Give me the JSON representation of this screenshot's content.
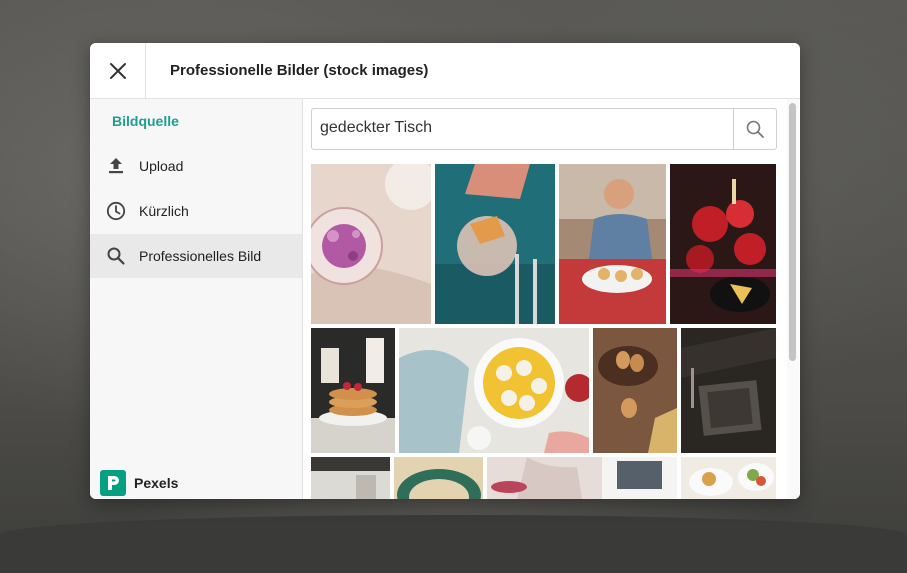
{
  "dialog": {
    "title": "Professionelle Bilder (stock images)"
  },
  "sidebar": {
    "heading": "Bildquelle",
    "heading_color": "#1e9e8e",
    "items": [
      {
        "label": "Upload",
        "icon": "upload-icon"
      },
      {
        "label": "Kürzlich",
        "icon": "clock-icon"
      },
      {
        "label": "Professionelles Bild",
        "icon": "search-icon",
        "active": true
      }
    ],
    "brand": {
      "label": "Pexels",
      "icon": "pexels-logo-icon",
      "color": "#05a081"
    }
  },
  "search": {
    "value": "gedeckter Tisch",
    "button_icon": "search-icon"
  },
  "results": [
    {
      "subject": "rosa-teller-blueten",
      "palette": [
        "#e7d6cc",
        "#c98bb6"
      ]
    },
    {
      "subject": "getraenk-auf-tuerkis",
      "palette": [
        "#1e6f78",
        "#e39a4a"
      ]
    },
    {
      "subject": "mann-am-tisch",
      "palette": [
        "#9f7d63",
        "#d44a45"
      ]
    },
    {
      "subject": "rote-blumen-kerzen",
      "palette": [
        "#3a1a1a",
        "#c9232b"
      ]
    },
    {
      "subject": "pfannkuchen",
      "palette": [
        "#2b2b2b",
        "#d49a56"
      ]
    },
    {
      "subject": "fingerfood-platte",
      "palette": [
        "#e9e6df",
        "#f1c232"
      ]
    },
    {
      "subject": "eier-holzbrett",
      "palette": [
        "#5a3a28",
        "#d39a5b"
      ]
    },
    {
      "subject": "dunkle-tischplatte",
      "palette": [
        "#2a2622",
        "#55504a"
      ]
    },
    {
      "subject": "kueche",
      "palette": [
        "#3a3835",
        "#dcdad4"
      ]
    },
    {
      "subject": "gruener-teller",
      "palette": [
        "#2f6f5a",
        "#e3d3b0"
      ]
    },
    {
      "subject": "person-am-tisch",
      "palette": [
        "#d7c8c3",
        "#b9455d"
      ]
    },
    {
      "subject": "salat-teller",
      "palette": [
        "#f0ece4",
        "#d9a24a"
      ]
    }
  ]
}
